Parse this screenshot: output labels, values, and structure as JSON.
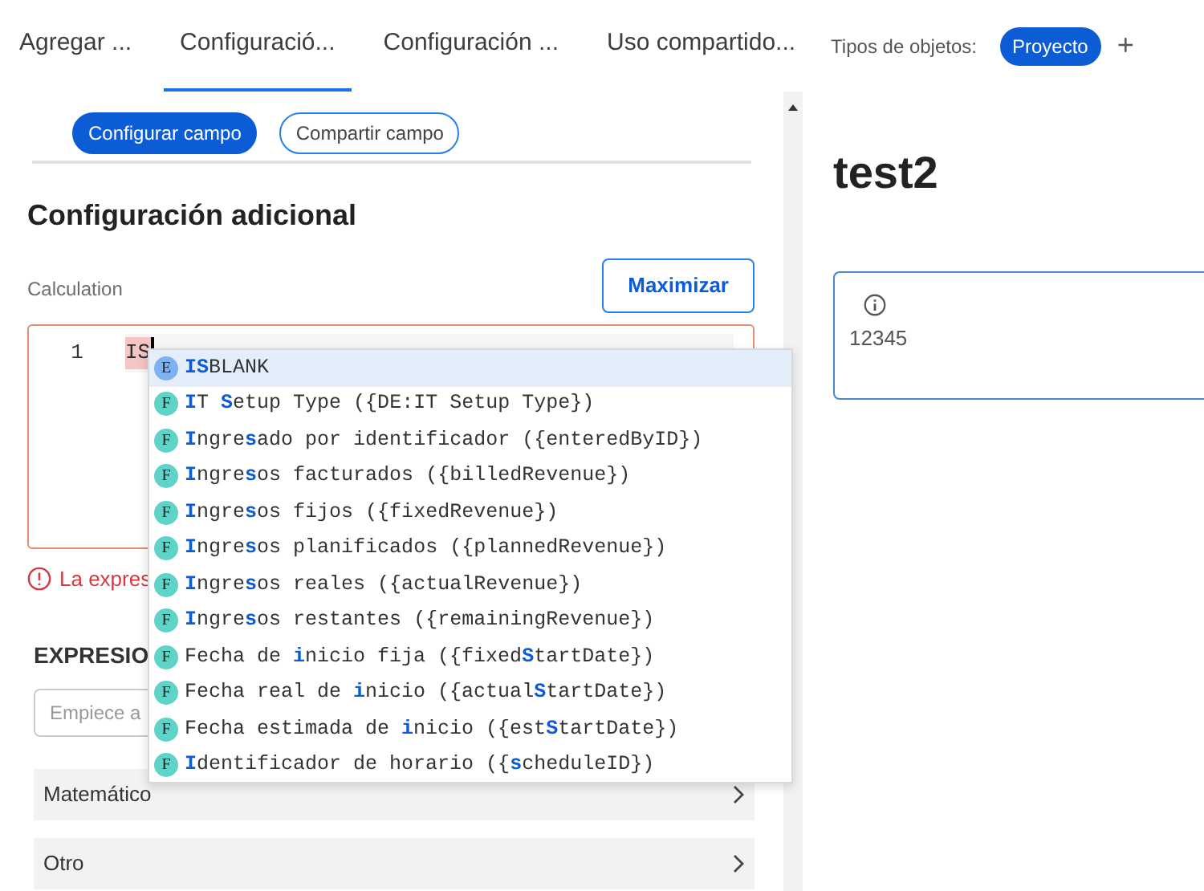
{
  "tabs": [
    {
      "label": "Agregar ...",
      "selected": false
    },
    {
      "label": "Configuració...",
      "selected": true
    },
    {
      "label": "Configuración ...",
      "selected": false
    },
    {
      "label": "Uso compartido...",
      "selected": false
    }
  ],
  "object_types": {
    "label": "Tipos de objetos:",
    "chips": [
      "Proyecto"
    ],
    "add": "+"
  },
  "sub_tabs": [
    {
      "label": "Configurar campo",
      "selected": true
    },
    {
      "label": "Compartir campo",
      "selected": false
    }
  ],
  "section_title": "Configuración adicional",
  "editor": {
    "label": "Calculation",
    "maximize": "Maximizar",
    "line_number": "1",
    "code": "IS",
    "error": "La expres"
  },
  "suggestions": [
    {
      "icon": "E",
      "color": "#7fb0f0",
      "text": "**IS**BLANK",
      "selected": true
    },
    {
      "icon": "F",
      "color": "#5fd3c8",
      "text": "**I**T **S**etup Type ({DE:IT Setup Type})",
      "selected": false
    },
    {
      "icon": "F",
      "color": "#5fd3c8",
      "text": "**I**ngre**s**ado por identificador ({enteredByID})",
      "selected": false
    },
    {
      "icon": "F",
      "color": "#5fd3c8",
      "text": "**I**ngre**s**os facturados ({billedRevenue})",
      "selected": false
    },
    {
      "icon": "F",
      "color": "#5fd3c8",
      "text": "**I**ngre**s**os fijos ({fixedRevenue})",
      "selected": false
    },
    {
      "icon": "F",
      "color": "#5fd3c8",
      "text": "**I**ngre**s**os planificados ({plannedRevenue})",
      "selected": false
    },
    {
      "icon": "F",
      "color": "#5fd3c8",
      "text": "**I**ngre**s**os reales ({actualRevenue})",
      "selected": false
    },
    {
      "icon": "F",
      "color": "#5fd3c8",
      "text": "**I**ngre**s**os restantes ({remainingRevenue})",
      "selected": false
    },
    {
      "icon": "F",
      "color": "#5fd3c8",
      "text": "Fecha de **i**nicio fija ({fixed**S**tartDate})",
      "selected": false
    },
    {
      "icon": "F",
      "color": "#5fd3c8",
      "text": "Fecha real de **i**nicio ({actual**S**tartDate})",
      "selected": false
    },
    {
      "icon": "F",
      "color": "#5fd3c8",
      "text": "Fecha estimada de **i**nicio ({est**S**tartDate})",
      "selected": false
    },
    {
      "icon": "F",
      "color": "#5fd3c8",
      "text": "**I**dentificador de horario ({**s**cheduleID})",
      "selected": false
    }
  ],
  "expressions": {
    "title": "EXPRESIO",
    "search_placeholder": "Empiece a",
    "groups": [
      "Matemático",
      "Otro"
    ]
  },
  "preview": {
    "title": "test2",
    "value": "12345"
  }
}
